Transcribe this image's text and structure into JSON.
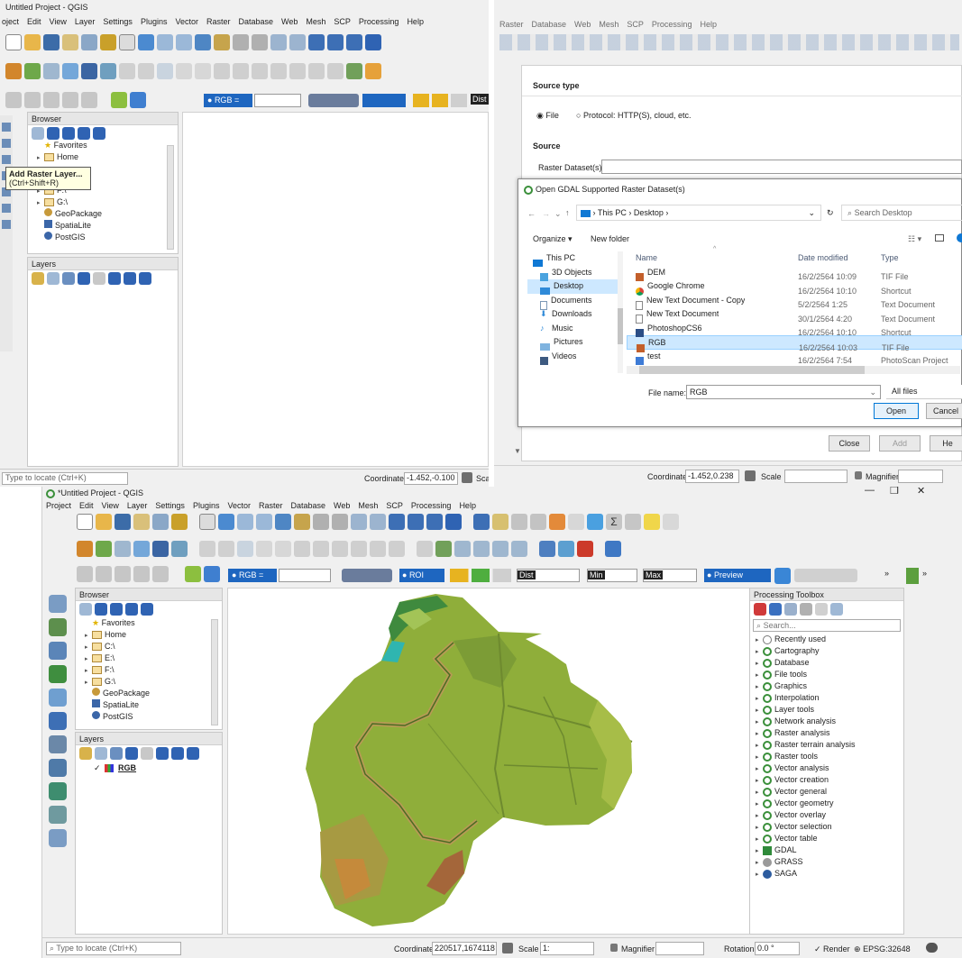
{
  "q1": {
    "title": "Untitled Project - QGIS",
    "menu": [
      "oject",
      "Edit",
      "View",
      "Layer",
      "Settings",
      "Plugins",
      "Vector",
      "Raster",
      "Database",
      "Web",
      "Mesh",
      "SCP",
      "Processing",
      "Help"
    ],
    "tooltip_title": "Add Raster Layer...",
    "tooltip_shortcut": "(Ctrl+Shift+R)",
    "combo_rgb": "RGB",
    "combo_dist": "Dist",
    "browser_title": "Browser",
    "browser_items": [
      "Favorites",
      "Home",
      "F:\\",
      "G:\\",
      "GeoPackage",
      "SpatiaLite",
      "PostGIS"
    ],
    "layers_title": "Layers",
    "locate_placeholder": "Type to locate (Ctrl+K)",
    "coord_label": "Coordinate",
    "coord_value": "-1.452,-0.100",
    "scale_partial": "Sca"
  },
  "q2": {
    "menu": [
      "Raster",
      "Database",
      "Web",
      "Mesh",
      "SCP",
      "Processing",
      "Help"
    ],
    "source_type_heading": "Source type",
    "radio_file": "File",
    "radio_protocol": "Protocol: HTTP(S), cloud, etc.",
    "source_heading": "Source",
    "raster_dataset_label": "Raster Dataset(s)",
    "dialog_title": "Open GDAL Supported Raster Dataset(s)",
    "path": [
      "This PC",
      "Desktop"
    ],
    "search_placeholder": "Search Desktop",
    "organize": "Organize",
    "new_folder": "New folder",
    "nav_items": [
      "This PC",
      "3D Objects",
      "Desktop",
      "Documents",
      "Downloads",
      "Music",
      "Pictures",
      "Videos"
    ],
    "columns": [
      "Name",
      "Date modified",
      "Type"
    ],
    "files": [
      {
        "name": "DEM",
        "date": "16/2/2564 10:09",
        "type": "TIF File"
      },
      {
        "name": "Google Chrome",
        "date": "16/2/2564 10:10",
        "type": "Shortcut"
      },
      {
        "name": "New Text Document - Copy",
        "date": "5/2/2564 1:25",
        "type": "Text Document"
      },
      {
        "name": "New Text Document",
        "date": "30/1/2564 4:20",
        "type": "Text Document"
      },
      {
        "name": "PhotoshopCS6",
        "date": "16/2/2564 10:10",
        "type": "Shortcut"
      },
      {
        "name": "RGB",
        "date": "16/2/2564 10:03",
        "type": "TIF File"
      },
      {
        "name": "test",
        "date": "16/2/2564 7:54",
        "type": "PhotoScan Project"
      }
    ],
    "filename_label": "File name:",
    "filename_value": "RGB",
    "filetype": "All files",
    "open": "Open",
    "cancel": "Cancel",
    "close": "Close",
    "add": "Add",
    "help": "He",
    "coord_label": "Coordinate",
    "coord_value": "-1.452,0.238",
    "scale_label": "Scale",
    "magnifier_label": "Magnifier"
  },
  "main": {
    "title": "*Untitled Project - QGIS",
    "menu": [
      "Project",
      "Edit",
      "View",
      "Layer",
      "Settings",
      "Plugins",
      "Vector",
      "Raster",
      "Database",
      "Web",
      "Mesh",
      "SCP",
      "Processing",
      "Help"
    ],
    "combo_rgb": "RGB =",
    "combo_roi": "ROI",
    "combo_dist": "Dist",
    "combo_min": "Min",
    "combo_max": "Max",
    "combo_preview": "Preview",
    "browser_title": "Browser",
    "browser_items": [
      "Favorites",
      "Home",
      "C:\\",
      "E:\\",
      "F:\\",
      "G:\\",
      "GeoPackage",
      "SpatiaLite",
      "PostGIS"
    ],
    "layers_title": "Layers",
    "layer_name": "RGB",
    "toolbox_title": "Processing Toolbox",
    "search_placeholder": "Search...",
    "toolbox_items": [
      "Recently used",
      "Cartography",
      "Database",
      "File tools",
      "Graphics",
      "Interpolation",
      "Layer tools",
      "Network analysis",
      "Raster analysis",
      "Raster terrain analysis",
      "Raster tools",
      "Vector analysis",
      "Vector creation",
      "Vector general",
      "Vector geometry",
      "Vector overlay",
      "Vector selection",
      "Vector table",
      "GDAL",
      "GRASS",
      "SAGA"
    ],
    "locate_placeholder": "Type to locate (Ctrl+K)",
    "coord_label": "Coordinate",
    "coord_value": "220517,1674118",
    "scale_label": "Scale",
    "scale_value": "1:",
    "magnifier_label": "Magnifier",
    "rotation_label": "Rotation",
    "rotation_value": "0.0 °",
    "render_label": "Render",
    "epsg": "EPSG:32648",
    "win_min": "—",
    "win_max": "❐",
    "win_close": "✕"
  },
  "colors": {
    "qgis_green": "#589632",
    "field_green": "#8fae3a",
    "water": "#2fb5b0",
    "select_blue": "#cde8ff",
    "accent_blue": "#0078d7"
  }
}
